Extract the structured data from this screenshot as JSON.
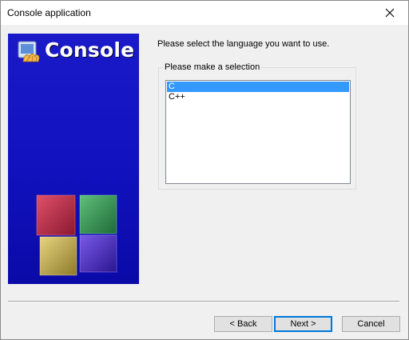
{
  "window": {
    "title": "Console application",
    "close_icon": "close-icon"
  },
  "banner": {
    "title": "Console",
    "logo_icon": "codeblocks-logo-icon",
    "image": "colored-cubes-graphic",
    "background_color": "#1414c4",
    "cube_colors": [
      "#b8233f",
      "#2f8f4f",
      "#c2b24a",
      "#4a2fbf"
    ]
  },
  "prompt": "Please select the language you want to use.",
  "selection": {
    "legend": "Please make a selection",
    "items": [
      {
        "label": "C",
        "selected": true
      },
      {
        "label": "C++",
        "selected": false
      }
    ],
    "selection_color": "#3399ff"
  },
  "buttons": {
    "back": "< Back",
    "next": "Next >",
    "cancel": "Cancel"
  }
}
